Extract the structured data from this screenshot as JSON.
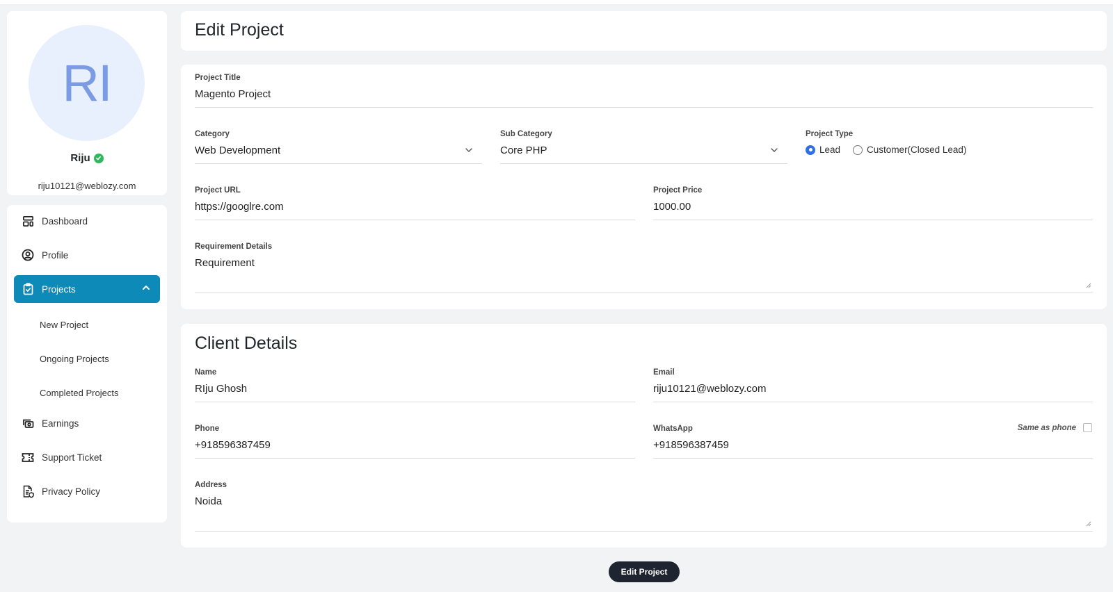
{
  "user": {
    "initials": "RI",
    "name": "Riju",
    "email": "riju10121@weblozy.com",
    "verified": true
  },
  "sidebar": {
    "items": [
      {
        "label": "Dashboard",
        "icon": "dashboard-icon"
      },
      {
        "label": "Profile",
        "icon": "user-circle-icon"
      },
      {
        "label": "Projects",
        "icon": "clipboard-check-icon",
        "active": true,
        "expanded": true
      },
      {
        "label": "Earnings",
        "icon": "cash-icon"
      },
      {
        "label": "Support Ticket",
        "icon": "ticket-icon"
      },
      {
        "label": "Privacy Policy",
        "icon": "document-shield-icon"
      }
    ],
    "project_subitems": [
      "New Project",
      "Ongoing Projects",
      "Completed Projects"
    ]
  },
  "header": {
    "title": "Edit Project"
  },
  "project_form": {
    "title_label": "Project Title",
    "title_value": "Magento Project",
    "category_label": "Category",
    "category_value": "Web Development",
    "subcategory_label": "Sub Category",
    "subcategory_value": "Core PHP",
    "type_label": "Project Type",
    "type_options": [
      "Lead",
      "Customer(Closed Lead)"
    ],
    "type_selected": "Lead",
    "url_label": "Project URL",
    "url_value": "https://googlre.com",
    "price_label": "Project Price",
    "price_value": "1000.00",
    "requirement_label": "Requirement Details",
    "requirement_value": "Requirement"
  },
  "client_form": {
    "section_title": "Client Details",
    "name_label": "Name",
    "name_value": "RIju Ghosh",
    "email_label": "Email",
    "email_value": "riju10121@weblozy.com",
    "phone_label": "Phone",
    "phone_value": "+918596387459",
    "whatsapp_label": "WhatsApp",
    "whatsapp_value": "+918596387459",
    "same_as_phone_label": "Same as phone",
    "same_as_phone_checked": false,
    "address_label": "Address",
    "address_value": "Noida"
  },
  "actions": {
    "submit_label": "Edit Project"
  },
  "colors": {
    "accent": "#0d8ab7",
    "radio_selected": "#2f6fe4",
    "button_bg": "#1e2530",
    "verified": "#2eb85c",
    "avatar_bg": "#e8f0fe",
    "avatar_text": "#7b9be3"
  }
}
